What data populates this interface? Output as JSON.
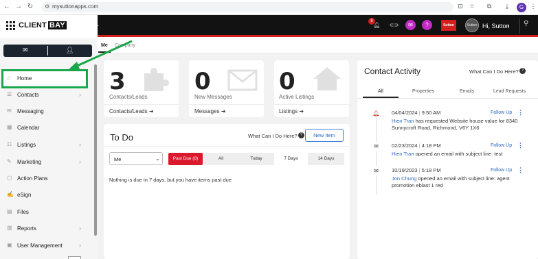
{
  "browser": {
    "url": "mysuttonapps.com",
    "profile_initial": "G"
  },
  "app": {
    "logo_text": "CLIENT",
    "logo_text_accent": "BAY",
    "notification_count": "8",
    "brand_badge": "Sutton",
    "avatar_text": "Sutton",
    "greeting": "Hi, Sutton",
    "colors": {
      "accent_red": "#d21f1f",
      "highlight_green": "#1aa64a",
      "link_blue": "#2a68c0",
      "purple": "#c22ac7",
      "header_dark": "#121212"
    }
  },
  "sidebar": {
    "items": [
      {
        "label": "Home",
        "icon": "home-icon",
        "chevron": false
      },
      {
        "label": "Contacts",
        "icon": "contacts-icon",
        "chevron": true
      },
      {
        "label": "Messaging",
        "icon": "messaging-icon",
        "chevron": false
      },
      {
        "label": "Calendar",
        "icon": "calendar-icon",
        "chevron": false
      },
      {
        "label": "Listings",
        "icon": "listings-icon",
        "chevron": true
      },
      {
        "label": "Marketing",
        "icon": "marketing-icon",
        "chevron": true
      },
      {
        "label": "Action Plans",
        "icon": "action-plans-icon",
        "chevron": false
      },
      {
        "label": "eSign",
        "icon": "esign-icon",
        "chevron": false
      },
      {
        "label": "Files",
        "icon": "files-icon",
        "chevron": false
      },
      {
        "label": "Reports",
        "icon": "reports-icon",
        "chevron": true
      },
      {
        "label": "User Management",
        "icon": "user-management-icon",
        "chevron": true
      }
    ]
  },
  "main": {
    "tabs": [
      "Me",
      "Company"
    ],
    "stats": [
      {
        "value": "3",
        "label": "Contacts/Leads",
        "link": "Contacts/Leads"
      },
      {
        "value": "0",
        "label": "New Messages",
        "link": "Messages"
      },
      {
        "value": "0",
        "label": "Active Listings",
        "link": "Listings"
      }
    ],
    "todo": {
      "title": "To Do",
      "help": "What Can I Do Here?",
      "new_item": "New Item",
      "owner": "Me",
      "filters": [
        "Past Due (8)",
        "All",
        "Today",
        "7 Days",
        "14 Days"
      ],
      "active_filter": "7 Days",
      "empty_message": "Nothing is due in 7 days, but you have items past due"
    },
    "contact_activity": {
      "title": "Contact Activity",
      "help": "What Can I Do Here?",
      "tabs": [
        "All",
        "Properties",
        "Emails",
        "Lead Requests"
      ],
      "follow_up": "Follow Up",
      "items": [
        {
          "icon": "bell-icon",
          "date": "04/04/2024",
          "time": "9:50 AM",
          "name": "Hien Tran",
          "text": " has requested Website house value for 8340 Sunnycroft Road, Richmond, V6Y 1X6"
        },
        {
          "icon": "envelope-icon",
          "date": "02/23/2024",
          "time": "4:18 PM",
          "name": "Hien Tran",
          "text": " opened an email with subject line: test"
        },
        {
          "icon": "envelope-icon",
          "date": "10/19/2023",
          "time": "5:18 PM",
          "name": "Jon Chung",
          "text": " opened an email with subject line: agent promotion eblast 1 red"
        }
      ]
    }
  }
}
